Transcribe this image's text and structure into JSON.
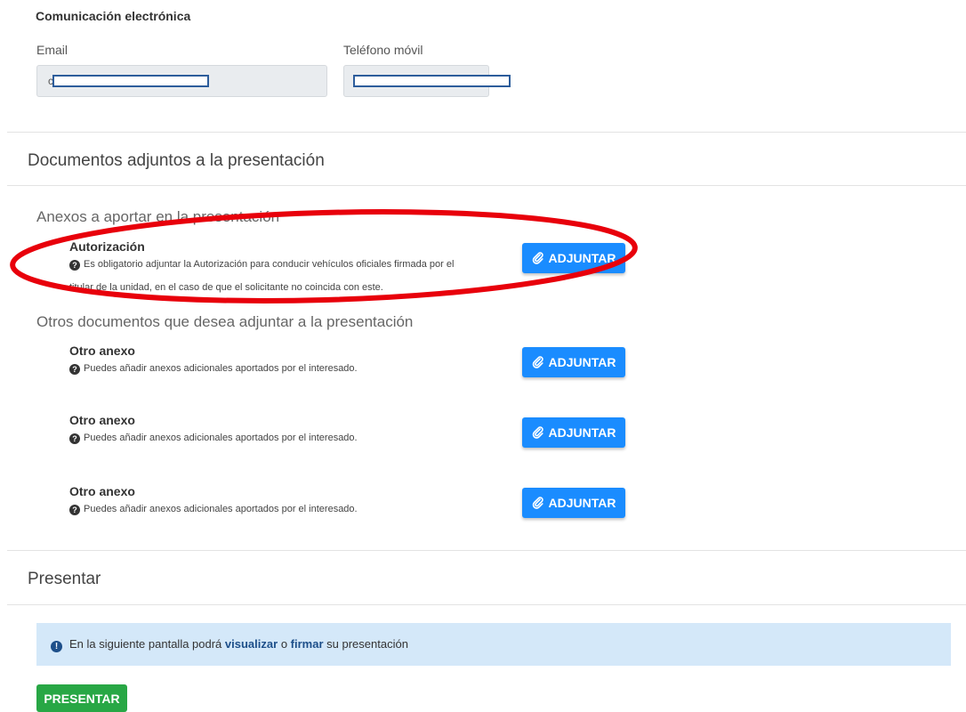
{
  "contact": {
    "section_title": "Comunicación electrónica",
    "email_label": "Email",
    "email_partial": "c",
    "phone_label": "Teléfono móvil"
  },
  "attachments": {
    "section_title": "Documentos adjuntos a la presentación",
    "required_group_title": "Anexos a aportar en la presentación",
    "required_doc": {
      "title": "Autorización",
      "help_line1": "Es obligatorio adjuntar la Autorización para conducir vehículos oficiales firmada por el",
      "help_line2": "titular de la unidad, en el caso de que el solicitante no coincida con este.",
      "button_label": "ADJUNTAR"
    },
    "other_group_title": "Otros documentos que desea adjuntar a la presentación",
    "other_docs": [
      {
        "title": "Otro anexo",
        "help": "Puedes añadir anexos adicionales aportados por el interesado.",
        "button_label": "ADJUNTAR"
      },
      {
        "title": "Otro anexo",
        "help": "Puedes añadir anexos adicionales aportados por el interesado.",
        "button_label": "ADJUNTAR"
      },
      {
        "title": "Otro anexo",
        "help": "Puedes añadir anexos adicionales aportados por el interesado.",
        "button_label": "ADJUNTAR"
      }
    ]
  },
  "submit": {
    "section_title": "Presentar",
    "info_prefix": "En la siguiente pantalla podrá",
    "info_link1": "visualizar",
    "info_mid": "o",
    "info_link2": "firmar",
    "info_suffix": "su presentación",
    "button_label": "PRESENTAR"
  },
  "colors": {
    "primary_button": "#1a8cff",
    "submit_button": "#28a745",
    "info_background": "#d4e8f9",
    "annotation_ellipse": "#e8000b"
  },
  "icons": {
    "help": "question-circle-icon",
    "attach": "paperclip-icon",
    "info": "exclamation-circle-icon"
  }
}
